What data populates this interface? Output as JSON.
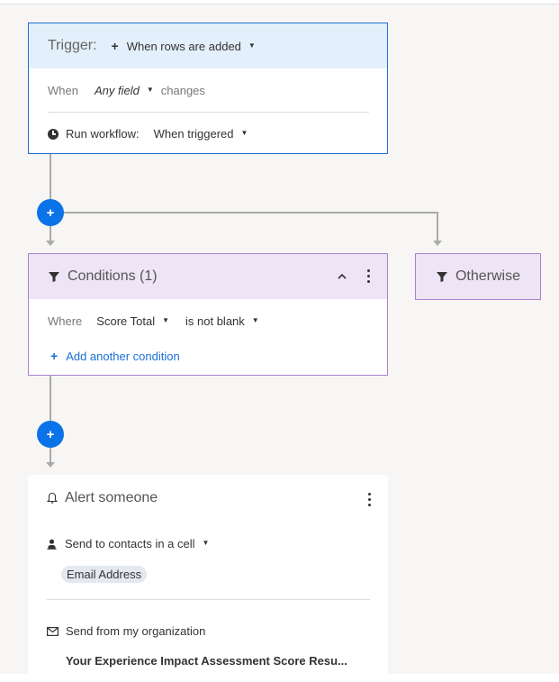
{
  "trigger": {
    "label": "Trigger:",
    "event": "When rows are added",
    "when_label": "When",
    "field": "Any field",
    "changes_label": "changes",
    "run_label": "Run workflow:",
    "run_value": "When triggered"
  },
  "conditions": {
    "title": "Conditions (1)",
    "where_label": "Where",
    "field": "Score Total",
    "operator": "is not blank",
    "add_label": "Add another condition"
  },
  "otherwise": {
    "title": "Otherwise"
  },
  "alert": {
    "title": "Alert someone",
    "send_to": "Send to contacts in a cell",
    "contact_column": "Email Address",
    "send_from": "Send from my organization",
    "subject": "Your Experience Impact Assessment Score Resu..."
  },
  "icons": {
    "add": "+",
    "caret": "▼",
    "chevron_up": "^"
  },
  "colors": {
    "trigger_border": "#1f6fd6",
    "trigger_header": "#e3effb",
    "condition_border": "#a982cf",
    "condition_header": "#ede4f5",
    "add_button": "#0a73e8",
    "link": "#1a6fd6"
  }
}
